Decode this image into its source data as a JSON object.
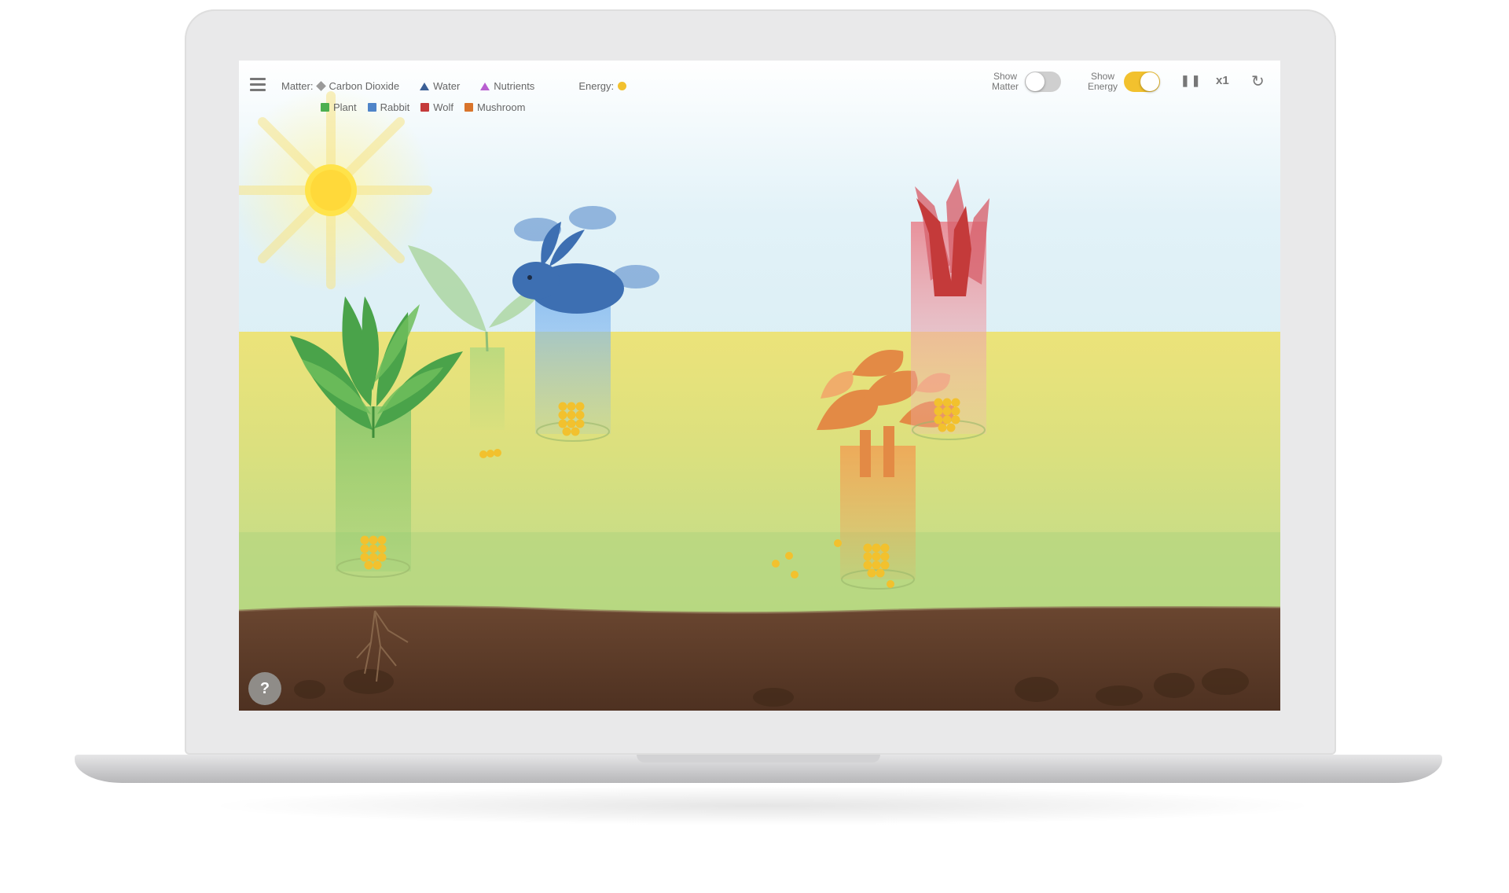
{
  "toolbar": {
    "matter_label": "Matter:",
    "energy_label": "Energy:",
    "matter_items": [
      {
        "label": "Carbon Dioxide",
        "icon": "diamond-icon",
        "color": "#9a9a9a"
      },
      {
        "label": "Water",
        "icon": "triangle-icon",
        "color": "#3b5f96"
      },
      {
        "label": "Nutrients",
        "icon": "triangle-icon",
        "color": "#b85fd0"
      }
    ],
    "organism_items": [
      {
        "label": "Plant",
        "icon": "cube-icon",
        "color": "#4caf50"
      },
      {
        "label": "Rabbit",
        "icon": "cube-icon",
        "color": "#4f84c8"
      },
      {
        "label": "Wolf",
        "icon": "cube-icon",
        "color": "#c43a3a"
      },
      {
        "label": "Mushroom",
        "icon": "cube-icon",
        "color": "#d9742b"
      }
    ],
    "energy_color": "#f2c12e",
    "show_matter": {
      "line1": "Show",
      "line2": "Matter",
      "on": false
    },
    "show_energy": {
      "line1": "Show",
      "line2": "Energy",
      "on": true
    },
    "pause_icon": "pause-icon",
    "speed": "x1",
    "reset_icon": "reset-icon"
  },
  "help": {
    "label": "?"
  },
  "colors": {
    "plant": "#4caf50",
    "rabbit": "#4f84c8",
    "wolf": "#c43a3a",
    "mushroom": "#d9742b",
    "energy": "#f2c12e",
    "toggle_on": "#f2c12e",
    "toggle_off": "#cfcfcf",
    "soil": "#5a3a24"
  }
}
